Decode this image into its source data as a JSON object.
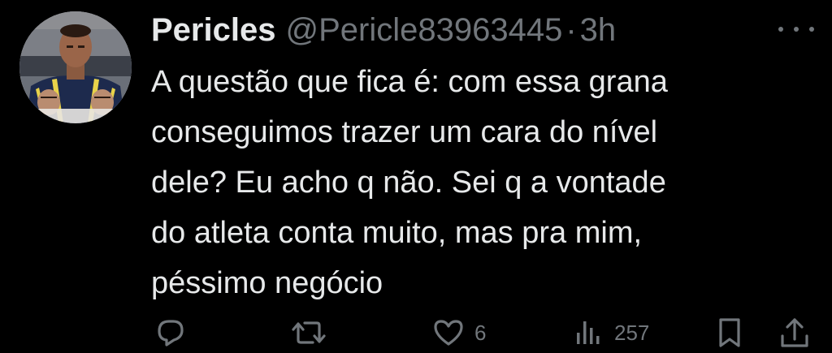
{
  "tweet": {
    "display_name": "Pericles",
    "handle": "@Pericle83963445",
    "separator": "·",
    "time": "3h",
    "text": "A questão que fica é: com essa grana\nconseguimos trazer  um cara do nível\ndele? Eu acho q não. Sei q a vontade\ndo atleta conta muito, mas pra mim,\npéssimo negócio",
    "likes": "6",
    "views": "257"
  },
  "colors": {
    "background": "#000000",
    "primary_text": "#e7e9ea",
    "secondary_text": "#71767b"
  },
  "icons": {
    "avatar": "avatar",
    "more": "more-icon",
    "reply": "reply-icon",
    "retweet": "retweet-icon",
    "like": "heart-icon",
    "views": "views-icon",
    "bookmark": "bookmark-icon",
    "share": "share-icon"
  }
}
